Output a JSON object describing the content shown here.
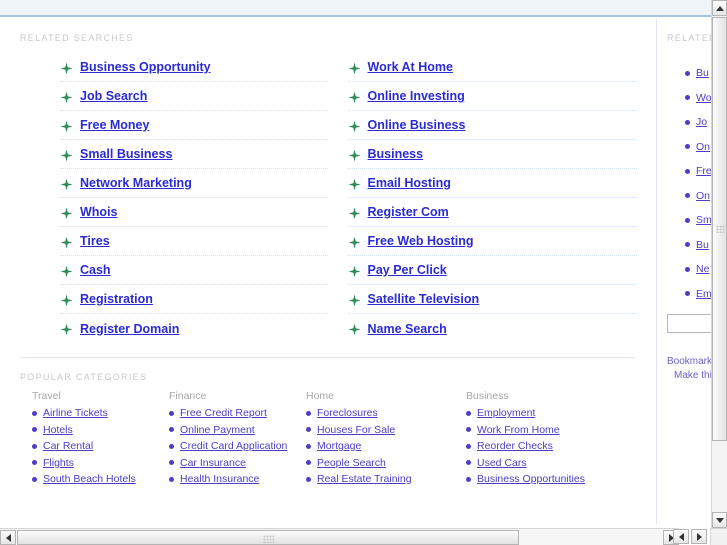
{
  "related_searches": {
    "heading": "RELATED SEARCHES",
    "left_column": [
      "Business Opportunity",
      "Job Search",
      "Free Money",
      "Small Business",
      "Network Marketing",
      "Whois",
      "Tires",
      "Cash",
      "Registration",
      "Register Domain"
    ],
    "right_column": [
      "Work At Home",
      "Online Investing",
      "Online Business",
      "Business",
      "Email Hosting",
      "Register Com",
      "Free Web Hosting",
      "Pay Per Click",
      "Satellite Television",
      "Name Search"
    ],
    "bullet_icon": "star-bullet-icon"
  },
  "popular_categories": {
    "heading": "POPULAR CATEGORIES",
    "columns": [
      {
        "title": "Travel",
        "items": [
          "Airline Tickets",
          "Hotels",
          "Car Rental",
          "Flights",
          "South Beach Hotels"
        ]
      },
      {
        "title": "Finance",
        "items": [
          "Free Credit Report",
          "Online Payment",
          "Credit Card Application",
          "Car Insurance",
          "Health Insurance"
        ]
      },
      {
        "title": "Home",
        "items": [
          "Foreclosures",
          "Houses For Sale",
          "Mortgage",
          "People Search",
          "Real Estate Training"
        ]
      },
      {
        "title": "Business",
        "items": [
          "Employment",
          "Work From Home",
          "Reorder Checks",
          "Used Cars",
          "Business Opportunities"
        ]
      }
    ],
    "bullet_icon": "dot-bullet-icon"
  },
  "sidebar": {
    "heading": "RELATED",
    "items": [
      "Bu",
      "Wo",
      "Jo",
      "On",
      "Fre",
      "On",
      "Sm",
      "Bu",
      "Ne",
      "Em"
    ],
    "search_value": "",
    "footer_lines": [
      "Bookmark",
      "Make thi"
    ]
  },
  "scrollbars": {
    "vertical_up": "scroll-up-arrow",
    "vertical_down": "scroll-down-arrow",
    "horizontal_left": "scroll-left-arrow",
    "horizontal_right": "scroll-right-arrow"
  },
  "colors": {
    "link_blue": "#2b2bd4",
    "link_violet": "#4b3fc4",
    "label_gray": "#c9c9c9",
    "header_band": "#eff4f9",
    "header_border": "#a9c6e0",
    "bullet_green": "#2e8b57"
  }
}
